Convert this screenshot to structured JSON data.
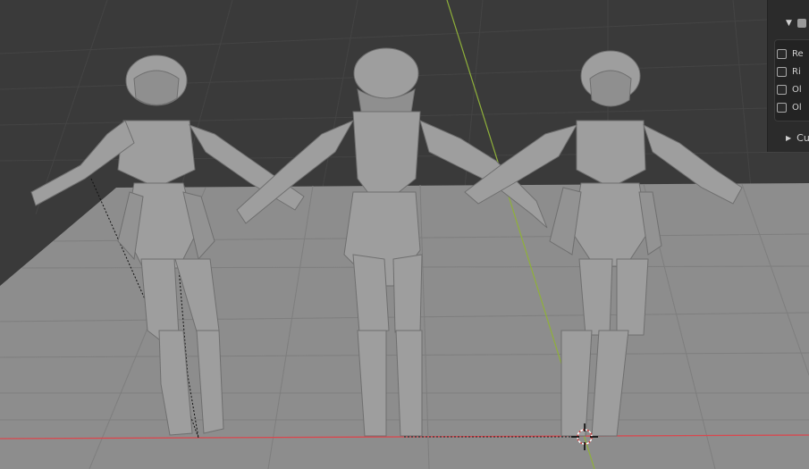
{
  "viewport": {
    "background": "#3a3a3a",
    "floor_color": "#8c8c8c",
    "grid_color": "#7c7c7c",
    "x_axis_color": "#d9484f",
    "y_axis_color": "#8fb03a",
    "figure_color": "#9e9e9e",
    "figures": [
      "figure-left",
      "figure-center",
      "figure-right"
    ]
  },
  "panel": {
    "header_icon": "collapse-triangle-icon",
    "checkbox_rows": [
      {
        "label": "Re",
        "checked": false
      },
      {
        "label": "Ri",
        "checked": false
      },
      {
        "label": "Ol",
        "checked": false
      },
      {
        "label": "Ol",
        "checked": false
      }
    ],
    "subpanel_label": "Cu"
  }
}
